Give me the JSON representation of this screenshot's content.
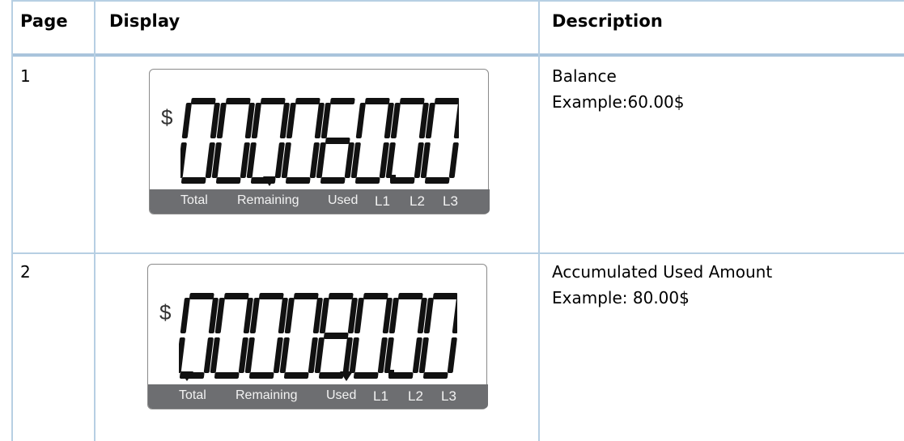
{
  "table": {
    "headers": {
      "page": "Page",
      "display": "Display",
      "description": "Description"
    },
    "rows": [
      {
        "page": "1",
        "lcd": {
          "currency": "$",
          "digits": "00006000",
          "arrows": [
            "Remaining"
          ]
        },
        "description": [
          "Balance",
          "Example:60.00$"
        ]
      },
      {
        "page": "2",
        "lcd": {
          "currency": "$",
          "digits": "00008000",
          "arrows": [
            "Total",
            "Used"
          ]
        },
        "description": [
          "Accumulated Used Amount",
          "Example: 80.00$"
        ]
      }
    ]
  },
  "lcd_labels": [
    "Total",
    "Remaining",
    "Used",
    "L1",
    "L2",
    "L3"
  ],
  "colors": {
    "grid": "#b7cfe3",
    "lcd_bar": "#6d6e71",
    "segment": "#111111"
  }
}
